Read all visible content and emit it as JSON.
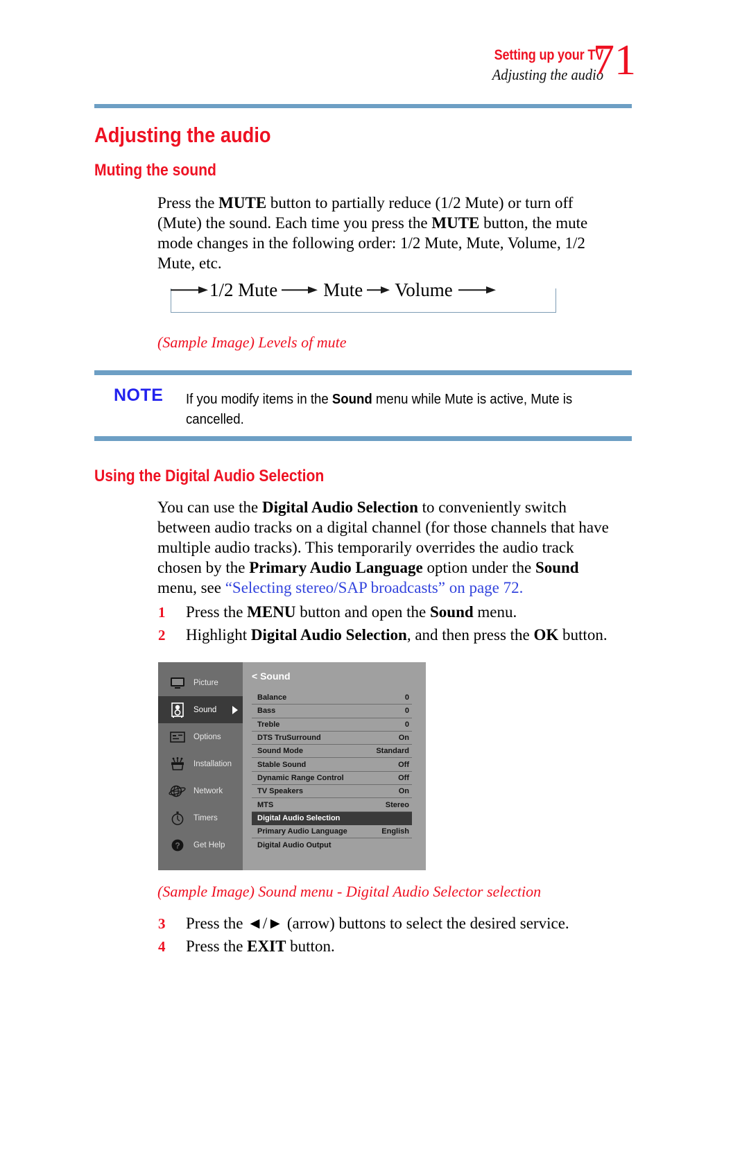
{
  "header": {
    "section": "Setting up your TV",
    "subsection": "Adjusting the audio",
    "page_number": "71"
  },
  "headings": {
    "h1": "Adjusting the audio",
    "muting": "Muting the sound",
    "digital_audio": "Using the Digital Audio Selection"
  },
  "muting": {
    "paragraph_parts": [
      {
        "t": "Press the ",
        "b": false
      },
      {
        "t": "MUTE",
        "b": true
      },
      {
        "t": " button to partially reduce (1/2 Mute) or turn off (Mute) the sound. Each time you press the ",
        "b": false
      },
      {
        "t": "MUTE",
        "b": true
      },
      {
        "t": " button, the mute mode changes in the following order: 1/2 Mute, Mute, Volume, 1/2 Mute, etc.",
        "b": false
      }
    ],
    "flow_steps": [
      "1/2 Mute",
      "Mute",
      "Volume"
    ],
    "caption": "(Sample Image) Levels of mute"
  },
  "note": {
    "label": "NOTE",
    "parts": [
      {
        "t": "If you modify items in the ",
        "b": false
      },
      {
        "t": "Sound",
        "b": true
      },
      {
        "t": " menu while Mute is active, Mute is cancelled.",
        "b": false
      }
    ]
  },
  "digital_audio": {
    "paragraph_parts": [
      {
        "t": "You can use the ",
        "b": false
      },
      {
        "t": "Digital Audio Selection",
        "b": true
      },
      {
        "t": " to conveniently switch between audio tracks on a digital channel (for those channels that have multiple audio tracks). This temporarily overrides the audio track chosen by the ",
        "b": false
      },
      {
        "t": "Primary Audio Language",
        "b": true
      },
      {
        "t": " option under the ",
        "b": false
      },
      {
        "t": "Sound",
        "b": true
      },
      {
        "t": " menu, see ",
        "b": false
      },
      {
        "t": "“Selecting stereo/SAP broadcasts” on page 72.",
        "b": false,
        "link": true
      }
    ],
    "steps": [
      {
        "num": "1",
        "parts": [
          {
            "t": "Press the ",
            "b": false
          },
          {
            "t": "MENU",
            "b": true
          },
          {
            "t": " button and open the ",
            "b": false
          },
          {
            "t": "Sound",
            "b": true
          },
          {
            "t": " menu.",
            "b": false
          }
        ]
      },
      {
        "num": "2",
        "parts": [
          {
            "t": "Highlight ",
            "b": false
          },
          {
            "t": "Digital Audio Selection",
            "b": true
          },
          {
            "t": ", and then press the ",
            "b": false
          },
          {
            "t": "OK",
            "b": true
          },
          {
            "t": " button.",
            "b": false
          }
        ]
      },
      {
        "num": "3",
        "parts": [
          {
            "t": "Press the ◄/► (arrow) buttons to select the desired service.",
            "b": false
          }
        ]
      },
      {
        "num": "4",
        "parts": [
          {
            "t": "Press the ",
            "b": false
          },
          {
            "t": "EXIT",
            "b": true
          },
          {
            "t": " button.",
            "b": false
          }
        ]
      }
    ],
    "menu_caption": "(Sample Image) Sound menu - Digital Audio Selector selection"
  },
  "tv_menu": {
    "title": "< Sound",
    "sidebar": [
      {
        "label": "Picture",
        "icon": "tv-monitor-icon",
        "selected": false
      },
      {
        "label": "Sound",
        "icon": "speaker-icon",
        "selected": true
      },
      {
        "label": "Options",
        "icon": "options-panel-icon",
        "selected": false
      },
      {
        "label": "Installation",
        "icon": "installation-toolbox-icon",
        "selected": false
      },
      {
        "label": "Network",
        "icon": "globe-network-icon",
        "selected": false
      },
      {
        "label": "Timers",
        "icon": "stopwatch-icon",
        "selected": false
      },
      {
        "label": "Get Help",
        "icon": "question-help-icon",
        "selected": false
      }
    ],
    "settings": [
      {
        "name": "Balance",
        "value": "0",
        "selected": false
      },
      {
        "name": "Bass",
        "value": "0",
        "selected": false
      },
      {
        "name": "Treble",
        "value": "0",
        "selected": false
      },
      {
        "name": "DTS TruSurround",
        "value": "On",
        "selected": false
      },
      {
        "name": "Sound Mode",
        "value": "Standard",
        "selected": false
      },
      {
        "name": "Stable Sound",
        "value": "Off",
        "selected": false
      },
      {
        "name": "Dynamic Range Control",
        "value": "Off",
        "selected": false
      },
      {
        "name": "TV Speakers",
        "value": "On",
        "selected": false
      },
      {
        "name": "MTS",
        "value": "Stereo",
        "selected": false
      },
      {
        "name": "Digital Audio Selection",
        "value": "",
        "selected": true
      },
      {
        "name": "Primary Audio Language",
        "value": "English",
        "selected": false
      },
      {
        "name": "Digital Audio Output",
        "value": "",
        "selected": false
      }
    ]
  },
  "colors": {
    "accent_red": "#ee1122",
    "rule_blue": "#6d9fc4",
    "note_blue": "#2222ee",
    "link_blue": "#3344dd"
  }
}
